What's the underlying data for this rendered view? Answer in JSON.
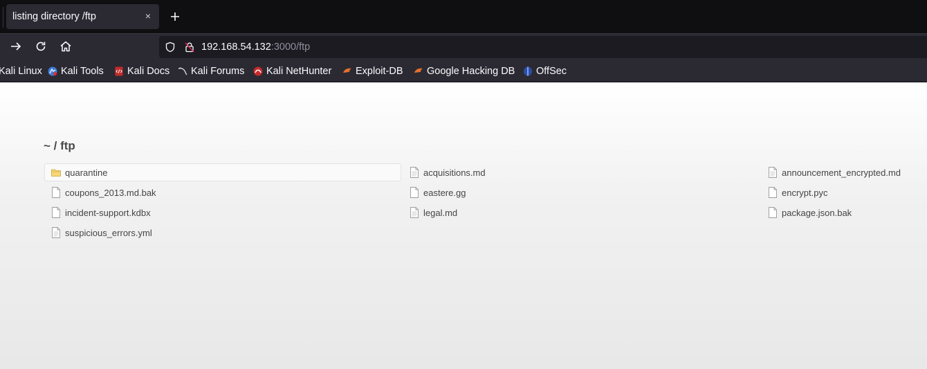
{
  "browser": {
    "tab_title": "listing directory /ftp",
    "tab_close": "×",
    "url_host": "192.168.54.132",
    "url_rest": ":3000/ftp"
  },
  "bookmarks": [
    {
      "label": "Kali Linux",
      "icon": "kali-icon"
    },
    {
      "label": "Kali Tools",
      "icon": "kali-tools-icon"
    },
    {
      "label": "Kali Docs",
      "icon": "kali-docs-icon"
    },
    {
      "label": "Kali Forums",
      "icon": "kali-dragon-icon"
    },
    {
      "label": "Kali NetHunter",
      "icon": "nethunter-icon"
    },
    {
      "label": "Exploit-DB",
      "icon": "exploit-db-icon"
    },
    {
      "label": "Google Hacking DB",
      "icon": "ghdb-icon"
    },
    {
      "label": "OffSec",
      "icon": "offsec-icon"
    }
  ],
  "listing": {
    "heading": "~ / ftp",
    "entries": [
      {
        "name": "quarantine",
        "type": "folder"
      },
      {
        "name": "acquisitions.md",
        "type": "file"
      },
      {
        "name": "announcement_encrypted.md",
        "type": "file"
      },
      {
        "name": "coupons_2013.md.bak",
        "type": "file"
      },
      {
        "name": "eastere.gg",
        "type": "file"
      },
      {
        "name": "encrypt.pyc",
        "type": "file"
      },
      {
        "name": "incident-support.kdbx",
        "type": "file"
      },
      {
        "name": "legal.md",
        "type": "file"
      },
      {
        "name": "package.json.bak",
        "type": "file"
      },
      {
        "name": "suspicious_errors.yml",
        "type": "file"
      }
    ]
  }
}
